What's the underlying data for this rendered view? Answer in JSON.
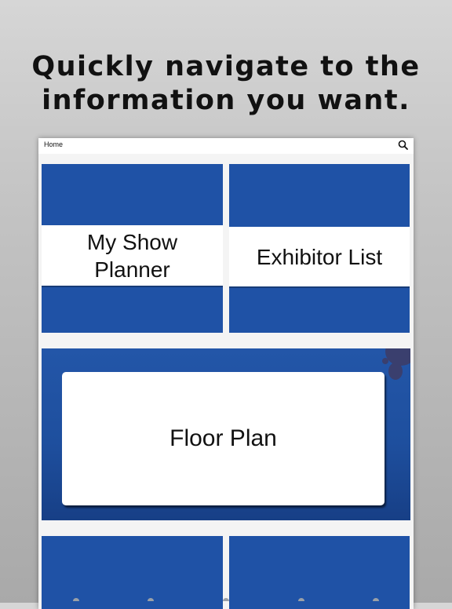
{
  "headline": {
    "line1": "Quickly navigate to the",
    "line2": "information you want."
  },
  "navbar": {
    "title": "Home",
    "search_icon": "search-icon"
  },
  "tiles": [
    {
      "label_line1": "My Show",
      "label_line2": "Planner"
    },
    {
      "label": "Exhibitor List"
    },
    {
      "label": "Floor Plan"
    }
  ],
  "tabbar": {
    "icons": [
      "home-tab-icon",
      "profile-tab-icon",
      "map-tab-icon",
      "calendar-tab-icon",
      "more-tab-icon"
    ]
  },
  "colors": {
    "tile_blue": "#1f52a6",
    "accent_dot": "#3a3f6e",
    "background": "#c3c3c3"
  }
}
